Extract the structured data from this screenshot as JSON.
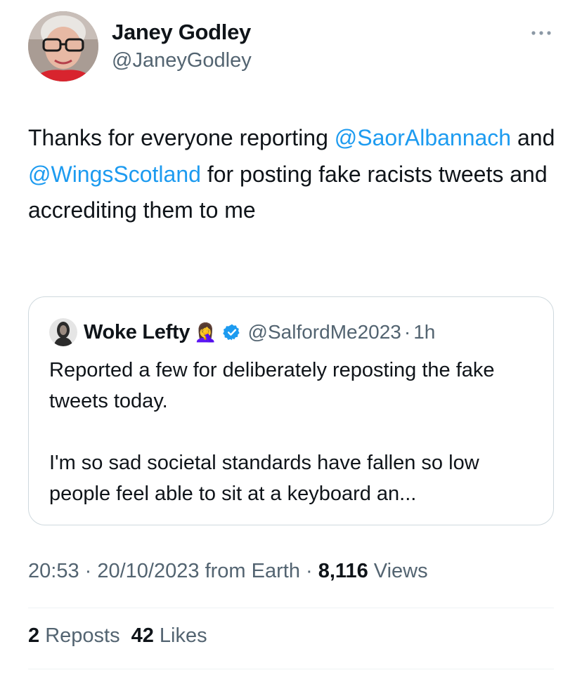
{
  "author": {
    "display_name": "Janey Godley",
    "handle": "@JaneyGodley",
    "avatar_icon": "profile-photo-woman-glasses"
  },
  "more_icon": "more-horizontal-icon",
  "tweet": {
    "text_1": "Thanks for everyone reporting ",
    "mention_1": "@SaorAlbannach",
    "text_2": " and ",
    "mention_2": "@WingsScotland",
    "text_3": " for posting fake racists tweets and accrediting them to me"
  },
  "quote": {
    "display_name": "Woke Lefty",
    "emoji": "🤦‍♀️",
    "verified_icon": "verified-badge-icon",
    "handle": "@SalfordMe2023",
    "separator": "·",
    "time": "1h",
    "paragraph_1": "Reported a few for deliberately reposting the fake tweets today.",
    "paragraph_2": "I'm so sad societal standards have fallen so low people feel able to sit at a keyboard an..."
  },
  "meta": {
    "time": "20:53",
    "sep1": " · ",
    "date": "20/10/2023",
    "source": " from Earth",
    "sep2": " · ",
    "views_count": "8,116",
    "views_label": " Views"
  },
  "stats": {
    "reposts_count": "2",
    "reposts_label": " Reposts",
    "likes_count": "42",
    "likes_label": " Likes"
  },
  "colors": {
    "link": "#1d9bf0",
    "secondary_text": "#536471",
    "primary_text": "#0f1419",
    "border": "#cfd9de"
  }
}
